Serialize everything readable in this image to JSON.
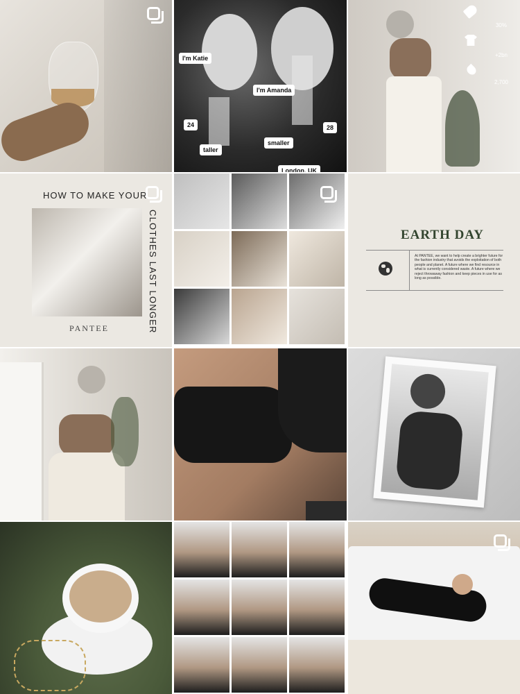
{
  "tiles": {
    "t2": {
      "stickers": {
        "katie": "I'm Katie",
        "amanda": "I'm Amanda",
        "age_left": "24",
        "age_right": "28",
        "taller": "taller",
        "smaller": "smaller",
        "location": "London, UK"
      }
    },
    "t3": {
      "stats": {
        "s1": "30%",
        "s2": "+2bn",
        "s3": "2,700"
      }
    },
    "t4": {
      "title": "HOW TO MAKE YOUR",
      "vertical": "CLOTHES LAST LONGER",
      "brand": "PANTEE"
    },
    "t6": {
      "title": "EARTH DAY",
      "body": "At PANTEE, we want to help create a brighter future for the fashion industry that avoids the exploitation of both people and planet. A future where we find resource in what is currently considered waste. A future where we reject throwaway fashion and keep pieces in use for as long as possible."
    }
  },
  "icons": {
    "multi": "carousel-icon",
    "tag": "price-tag-icon",
    "shirt": "tshirt-icon",
    "drop": "water-drop-icon",
    "globe": "globe-icon"
  },
  "colors": {
    "background": "#ffffff",
    "post_bg": "#ebe8e2",
    "earth_day": "#33452f"
  }
}
